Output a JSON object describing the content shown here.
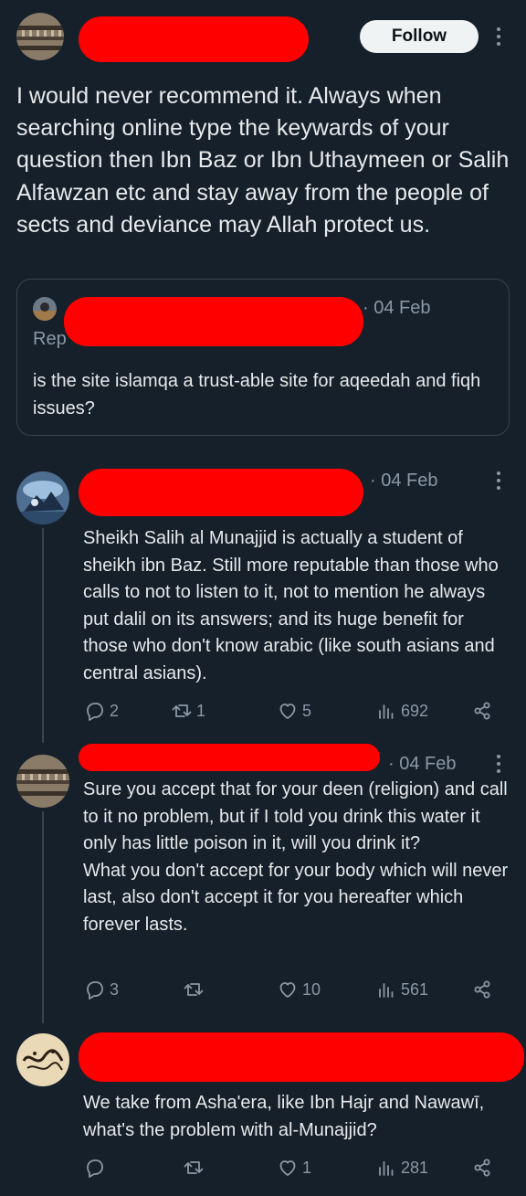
{
  "main_post": {
    "follow_label": "Follow",
    "text": "I would never recommend it. Always when searching online type the keywards of your question then Ibn Baz or Ibn Uthaymeen or Salih Alfawzan etc and stay away from the people of sects and deviance may Allah protect us."
  },
  "quoted": {
    "date": "· 04 Feb",
    "reply_prefix": "Rep",
    "text": "is the site islamqa a trust-able site for aqeedah and fiqh issues?"
  },
  "replies": [
    {
      "date": "· 04 Feb",
      "text": "Sheikh Salih al Munajjid is actually a student of sheikh ibn Baz. Still more reputable than those who calls to not to listen to it, not to mention he always put dalil on its answers; and its huge benefit for those who don't know arabic (like south asians and central asians).",
      "reply_count": "2",
      "repost_count": "1",
      "like_count": "5",
      "views": "692"
    },
    {
      "date": "· 04 Feb",
      "text": "Sure you accept that for your deen (religion) and call to it no problem, but if I told you drink this water it only has little poison in it, will you drink it?\nWhat you don't accept for your body which will never last, also don't accept it for you hereafter which forever lasts.",
      "reply_count": "3",
      "repost_count": "",
      "like_count": "10",
      "views": "561"
    },
    {
      "date": "",
      "text": "We take from Asha'era, like Ibn Hajr and Nawawī, what's the problem with al-Munajjid?",
      "reply_count": "",
      "repost_count": "",
      "like_count": "1",
      "views": "281"
    }
  ],
  "colors": {
    "background": "#15202b",
    "text": "#e7e9ea",
    "muted": "#8b98a5",
    "redaction": "#ff0000"
  }
}
